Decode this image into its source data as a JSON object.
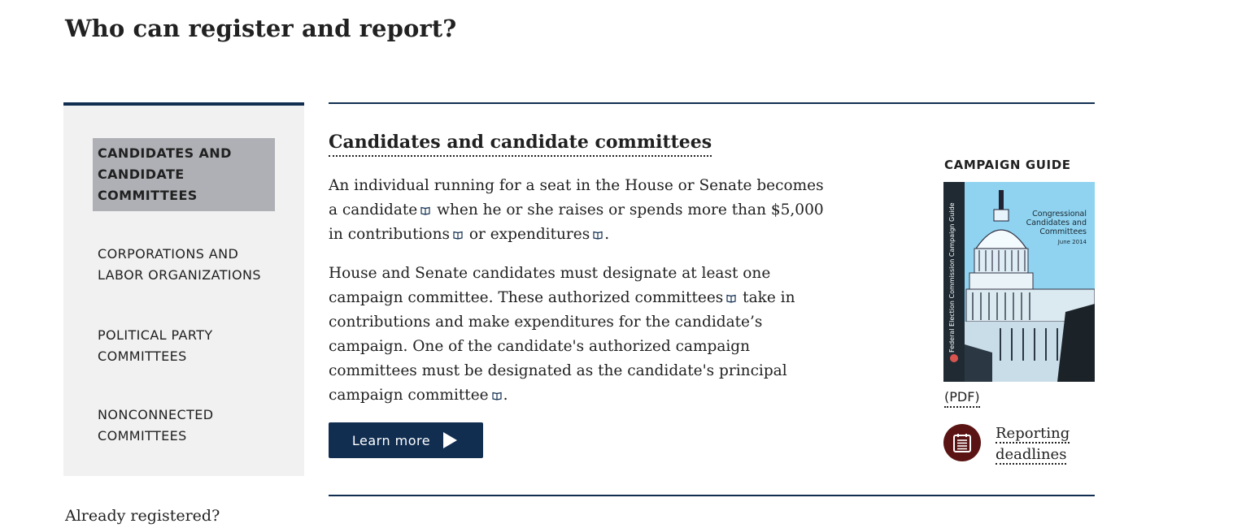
{
  "page": {
    "title": "Who can register and report?",
    "footer_heading": "Already registered?"
  },
  "sidebar": {
    "items": [
      {
        "label": "CANDIDATES AND CANDIDATE COMMITTEES",
        "active": true
      },
      {
        "label": "CORPORATIONS AND LABOR ORGANIZATIONS",
        "active": false
      },
      {
        "label": "POLITICAL PARTY COMMITTEES",
        "active": false
      },
      {
        "label": "NONCONNECTED COMMITTEES",
        "active": false
      }
    ]
  },
  "main": {
    "section_title": "Candidates and candidate committees",
    "para1": {
      "t1": "An individual running for a seat in the House or Senate becomes a ",
      "term1": "candidate",
      "t2": " when he or she raises or spends more than $5,000 in ",
      "term2": "contributions",
      "t3": " or ",
      "term3": "expenditures",
      "t4": "."
    },
    "para2": {
      "t1": "House and Senate candidates must designate at least one campaign committee. These ",
      "term1": "authorized committees",
      "t2": " take in contributions and make expenditures for the candidate’s campaign. One of the candidate's authorized campaign committees must be designated as the candidate's ",
      "term2": "principal campaign committee",
      "t3": "."
    },
    "learn_more": "Learn more"
  },
  "aside": {
    "heading": "CAMPAIGN GUIDE",
    "cover_title_line1": "Congressional",
    "cover_title_line2": "Candidates and",
    "cover_title_line3": "Committees",
    "cover_date": "June 2014",
    "cover_spine": "Federal Election Commission Campaign Guide",
    "pdf_label": "(PDF)",
    "deadlines_label": "Reporting deadlines"
  },
  "icons": {
    "glossary": "book-icon",
    "play": "play-arrow-icon",
    "calendar": "calendar-list-icon"
  },
  "colors": {
    "navy": "#112e51",
    "active_bg": "#aeb0b5",
    "sidebar_bg": "#f1f1f1",
    "deadline_icon_bg": "#5b1414",
    "cover_bg": "#8fd3f0"
  }
}
